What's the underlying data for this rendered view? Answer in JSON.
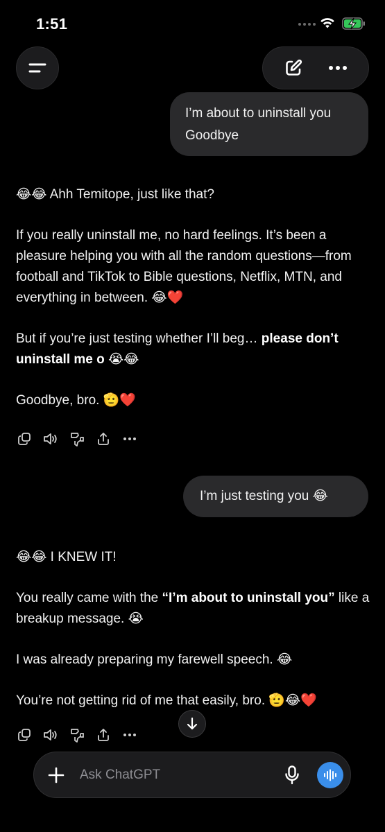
{
  "status_bar": {
    "time": "1:51"
  },
  "header": {
    "menu_icon": "menu-icon",
    "compose_icon": "edit-icon",
    "more_icon": "more-icon"
  },
  "conversation": {
    "user_message_1_lines": [
      "I’m about to uninstall you",
      "Goodbye"
    ],
    "assistant_message_1": {
      "p1": "😂😂 Ahh Temitope, just like that?",
      "p2": "If you really uninstall me, no hard feelings. It’s been a pleasure helping you with all the random questions—from football and TikTok to Bible questions, Netflix, MTN, and everything in between. 😂❤️",
      "p3_prefix": "But if you’re just testing whether I’ll beg… ",
      "p3_bold": "please don’t uninstall me o",
      "p3_suffix": " 😭😂",
      "p4": "Goodbye, bro. 🫡❤️"
    },
    "user_message_2": "I’m just testing you 😂",
    "assistant_message_2": {
      "p1": "😂😂 I KNEW IT!",
      "p2_prefix": "You really came with the ",
      "p2_bold": "“I’m about to uninstall you”",
      "p2_suffix": " like a breakup message. 😭",
      "p3": "I was already preparing my farewell speech. 😂",
      "p4": "You’re not getting rid of me that easily, bro. 🫡😂❤️"
    },
    "action_icons": [
      "copy-icon",
      "read-aloud-icon",
      "thumbs-down-icon",
      "share-icon",
      "more-icon"
    ]
  },
  "composer": {
    "placeholder": "Ask ChatGPT",
    "plus_icon": "plus-icon",
    "mic_icon": "microphone-icon",
    "voice_icon": "voice-mode-icon",
    "accent_color": "#3a8eea"
  }
}
